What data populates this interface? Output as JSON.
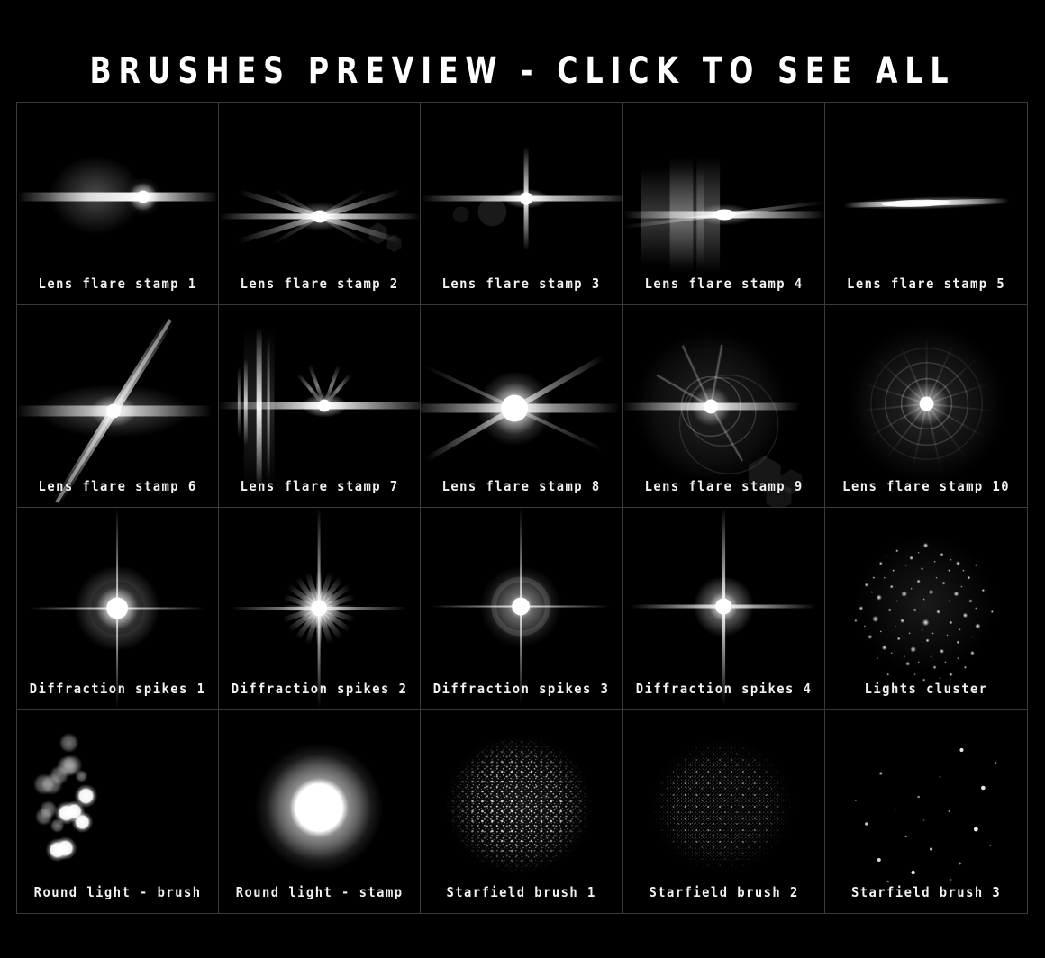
{
  "header": {
    "title": "BRUSHES PREVIEW - CLICK TO SEE ALL"
  },
  "colors": {
    "background": "#000000",
    "grid_line": "#3a3a3a",
    "label_text": "#f2f2f2",
    "glow": "#ffffff"
  },
  "grid": {
    "columns": 5,
    "rows": 4,
    "cells": [
      {
        "label": "Lens flare stamp 1",
        "art": "flare-streak-offcore"
      },
      {
        "label": "Lens flare stamp 2",
        "art": "flare-x-rays"
      },
      {
        "label": "Lens flare stamp 3",
        "art": "flare-cross-ghosts"
      },
      {
        "label": "Lens flare stamp 4",
        "art": "flare-wide-bars"
      },
      {
        "label": "Lens flare stamp 5",
        "art": "flare-thin-streak"
      },
      {
        "label": "Lens flare stamp 6",
        "art": "flare-anamorphic-star"
      },
      {
        "label": "Lens flare stamp 7",
        "art": "flare-vertical-bars"
      },
      {
        "label": "Lens flare stamp 8",
        "art": "flare-bright-burst"
      },
      {
        "label": "Lens flare stamp 9",
        "art": "flare-rings-hex"
      },
      {
        "label": "Lens flare stamp 10",
        "art": "flare-concentric-rays"
      },
      {
        "label": "Diffraction spikes 1",
        "art": "spikes-halo-cross"
      },
      {
        "label": "Diffraction spikes 2",
        "art": "spikes-sunburst"
      },
      {
        "label": "Diffraction spikes 3",
        "art": "spikes-soft-cross"
      },
      {
        "label": "Diffraction spikes 4",
        "art": "spikes-sharp-cross"
      },
      {
        "label": "Lights cluster",
        "art": "lights-cluster"
      },
      {
        "label": "Round light - brush",
        "art": "round-light-brush"
      },
      {
        "label": "Round light - stamp",
        "art": "round-light-stamp"
      },
      {
        "label": "Starfield brush 1",
        "art": "starfield-dense"
      },
      {
        "label": "Starfield brush 2",
        "art": "starfield-fine"
      },
      {
        "label": "Starfield brush 3",
        "art": "starfield-sparse"
      }
    ]
  }
}
